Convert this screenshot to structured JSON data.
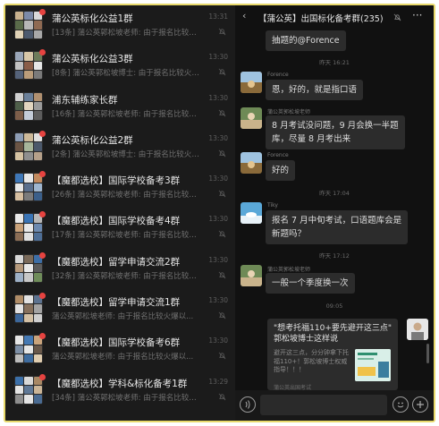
{
  "chat_list": [
    {
      "name": "蒲公英标化公益1群",
      "preview": "[13条] 蒲公英郭松坡老师: 由于报名比较火爆以...",
      "time": "13:31",
      "muted": true,
      "unread": true
    },
    {
      "name": "蒲公英标化公益3群",
      "preview": "[8条] 蒲公英郭松坡博士: 由于报名比较火爆以...",
      "time": "13:30",
      "muted": true,
      "unread": true
    },
    {
      "name": "浦东辅练家长群",
      "preview": "[16条] 蒲公英郭松坡老师: 由于报名比较火爆以...",
      "time": "13:30",
      "muted": true,
      "unread": false
    },
    {
      "name": "蒲公英标化公益2群",
      "preview": "[2条] 蒲公英郭松坡博士: 由于报名比较火爆以...",
      "time": "13:30",
      "muted": true,
      "unread": true
    },
    {
      "name": "【魔都选校】国际学校备考3群",
      "preview": "[26条] 蒲公英郭松坡老师: 由于报名比较火爆以...",
      "time": "13:30",
      "muted": true,
      "unread": true
    },
    {
      "name": "【魔都选校】国际学校备考4群",
      "preview": "[17条] 蒲公英郭松坡老师: 由于报名比较火爆以...",
      "time": "13:30",
      "muted": true,
      "unread": true
    },
    {
      "name": "【魔都选校】留学申请交流2群",
      "preview": "[32条] 蒲公英郭松坡老师: 由于报名比较火爆以...",
      "time": "13:30",
      "muted": true,
      "unread": true
    },
    {
      "name": "【魔都选校】留学申请交流1群",
      "preview": "蒲公英郭松坡老师: 由于报名比较火爆以...",
      "time": "13:30",
      "muted": true,
      "unread": true
    },
    {
      "name": "【魔都选校】国际学校备考6群",
      "preview": "蒲公英郭松坡老师: 由于报名比较火爆以...",
      "time": "13:30",
      "muted": true,
      "unread": true
    },
    {
      "name": "【魔都选校】学科&标化备考1群",
      "preview": "[34条] 蒲公英郭松坡老师: 由于报名比较火爆以...",
      "time": "13:29",
      "muted": true,
      "unread": true
    }
  ],
  "chat": {
    "back_icon": "chevron-left-icon",
    "title": "【蒲公英】出国标化备考群(235)",
    "messages": {
      "m0_text": "抽题的@Forence",
      "ts1": "昨天 16:21",
      "m1_sender": "Forence",
      "m1_text": "恩，好的，就是指口语",
      "m2_sender": "蒲公英郭松坡老师",
      "m2_line1": "8 月考试没问题，9 月会换一半题",
      "m2_line2": "库，尽量 8 月考出来",
      "m3_sender": "Forence",
      "m3_text": "好的",
      "ts2": "昨天 17:04",
      "m4_sender": "Tiky",
      "m4_line1": "报名 7 月中旬考试，口语题库会是",
      "m4_line2": "新题吗？",
      "ts3": "昨天 17:12",
      "m5_sender": "蒲公英郭松坡老师",
      "m5_text": "一般一个季度换一次",
      "ts4": "09:05"
    },
    "card": {
      "title": "\"想考托福110+要先避开这三点\" 郭松坡博士这样说",
      "desc": "避开这三点，分分钟拿下托福110+！郭松坡博士权威指导！！！",
      "source": "蒲公英出国考试"
    }
  },
  "colors": {
    "unread_dot": "#e64340",
    "bubble": "#2c2c2c",
    "background": "#1b1b1b",
    "frame": "#e8d96b"
  }
}
